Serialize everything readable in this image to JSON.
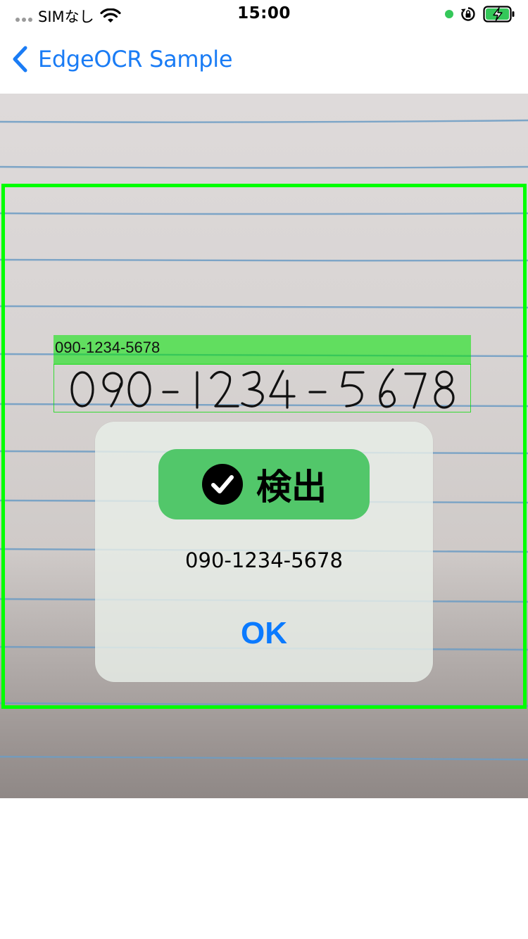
{
  "status_bar": {
    "carrier": "SIMなし",
    "time": "15:00",
    "icons": [
      "signal-dots-icon",
      "wifi-icon",
      "mic-indicator-dot",
      "rotation-lock-icon",
      "battery-charging-icon"
    ],
    "indicator_color": "#34c759",
    "battery_color": "#34c759"
  },
  "nav": {
    "back_icon": "chevron-left-icon",
    "title": "EdgeOCR Sample",
    "accent_color": "#1a7cf5"
  },
  "camera": {
    "frame_color": "#00ff00",
    "detection": {
      "label": "090-1234-5678",
      "handwritten_text": "090-1234-5678"
    }
  },
  "alert": {
    "status_icon": "checkmark-circle-icon",
    "status_label": "検出",
    "status_color": "#52c76a",
    "message": "090-1234-5678",
    "ok_label": "OK",
    "ok_color": "#0a7aff"
  }
}
